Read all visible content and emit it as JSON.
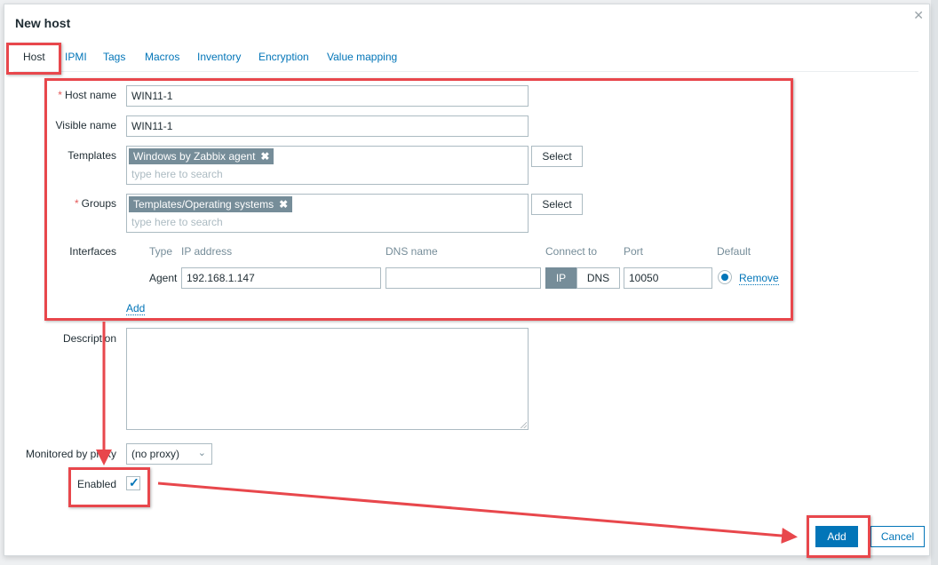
{
  "dialog": {
    "title": "New host",
    "close_icon": "close-icon"
  },
  "tabs": [
    {
      "label": "Host",
      "active": true
    },
    {
      "label": "IPMI"
    },
    {
      "label": "Tags"
    },
    {
      "label": "Macros"
    },
    {
      "label": "Inventory"
    },
    {
      "label": "Encryption"
    },
    {
      "label": "Value mapping"
    }
  ],
  "form": {
    "host_name": {
      "label": "Host name",
      "required": "*",
      "value": "WIN11-1"
    },
    "visible_name": {
      "label": "Visible name",
      "value": "WIN11-1"
    },
    "templates": {
      "label": "Templates",
      "chips": [
        "Windows by Zabbix agent"
      ],
      "placeholder": "type here to search",
      "select_label": "Select"
    },
    "groups": {
      "label": "Groups",
      "required": "*",
      "chips": [
        "Templates/Operating systems"
      ],
      "placeholder": "type here to search",
      "select_label": "Select"
    },
    "interfaces": {
      "label": "Interfaces",
      "columns": [
        "Type",
        "IP address",
        "DNS name",
        "Connect to",
        "Port",
        "Default"
      ],
      "rows": [
        {
          "type": "Agent",
          "ip": "192.168.1.147",
          "dns": "",
          "connect_options": [
            "IP",
            "DNS"
          ],
          "connect_selected": "IP",
          "port": "10050",
          "default": true,
          "remove_label": "Remove"
        }
      ],
      "add_label": "Add"
    },
    "description": {
      "label": "Description",
      "value": ""
    },
    "proxy": {
      "label": "Monitored by proxy",
      "value": "(no proxy)"
    },
    "enabled": {
      "label": "Enabled",
      "checked": true
    }
  },
  "footer": {
    "add_label": "Add",
    "cancel_label": "Cancel"
  },
  "colors": {
    "accent": "#0275b8",
    "chip": "#768d99",
    "annotation": "#e8474c",
    "required": "#e45959"
  }
}
